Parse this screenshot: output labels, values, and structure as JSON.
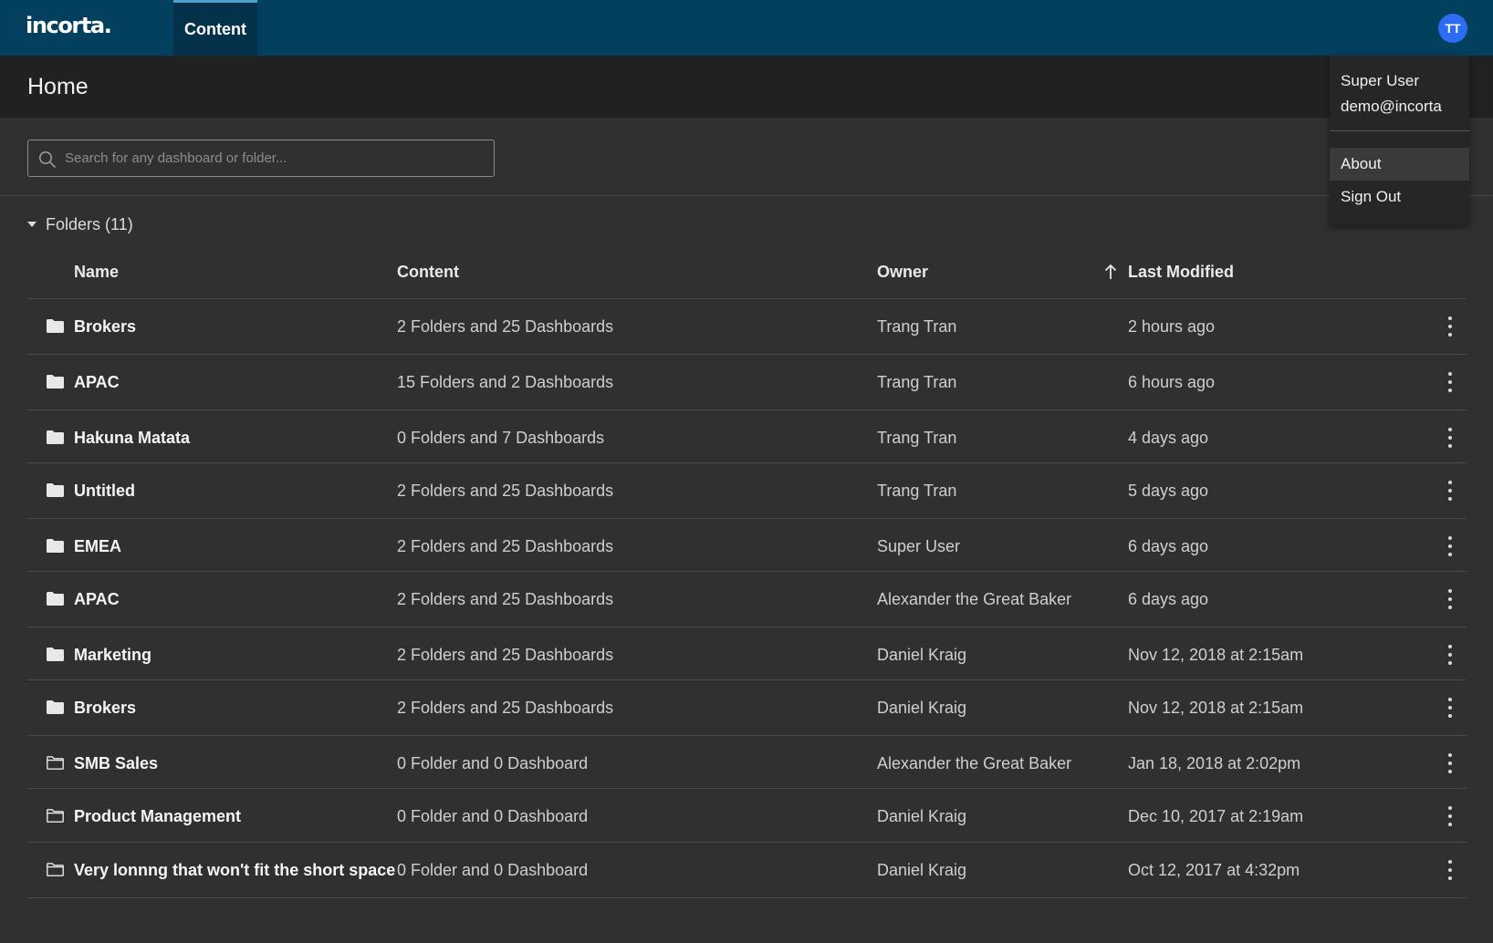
{
  "app": {
    "logo": "incorta.",
    "nav_tab": "Content",
    "avatar_initials": "TT",
    "accent_color": "#03405e",
    "avatar_color": "#2b6cf2"
  },
  "page": {
    "title": "Home"
  },
  "search": {
    "placeholder": "Search for any dashboard or folder..."
  },
  "folders": {
    "toggle_label": "Folders (11)",
    "columns": {
      "name": "Name",
      "content": "Content",
      "owner": "Owner",
      "modified": "Last Modified"
    },
    "sort": {
      "column": "Last Modified",
      "direction": "ascending-arrow"
    },
    "rows": [
      {
        "name": "Brokers",
        "content": "2 Folders and 25 Dashboards",
        "owner": "Trang Tran",
        "modified": "2 hours ago",
        "icon": "folder-filled-icon"
      },
      {
        "name": "APAC",
        "content": "15 Folders and 2 Dashboards",
        "owner": "Trang Tran",
        "modified": "6 hours ago",
        "icon": "folder-filled-icon"
      },
      {
        "name": "Hakuna Matata",
        "content": "0 Folders and 7 Dashboards",
        "owner": "Trang Tran",
        "modified": "4 days ago",
        "icon": "folder-filled-icon"
      },
      {
        "name": "Untitled",
        "content": "2 Folders and 25 Dashboards",
        "owner": "Trang Tran",
        "modified": "5 days ago",
        "icon": "folder-filled-icon"
      },
      {
        "name": "EMEA",
        "content": "2 Folders and 25 Dashboards",
        "owner": "Super User",
        "modified": "6 days ago",
        "icon": "folder-filled-icon"
      },
      {
        "name": "APAC",
        "content": "2 Folders and 25 Dashboards",
        "owner": "Alexander the Great Baker",
        "modified": "6 days ago",
        "icon": "folder-filled-icon"
      },
      {
        "name": "Marketing",
        "content": "2 Folders and 25 Dashboards",
        "owner": "Daniel Kraig",
        "modified": "Nov 12, 2018 at 2:15am",
        "icon": "folder-filled-icon"
      },
      {
        "name": "Brokers",
        "content": "2 Folders and 25 Dashboards",
        "owner": "Daniel Kraig",
        "modified": "Nov 12, 2018 at 2:15am",
        "icon": "folder-filled-icon"
      },
      {
        "name": "SMB Sales",
        "content": "0 Folder and 0 Dashboard",
        "owner": "Alexander the Great Baker",
        "modified": "Jan 18, 2018 at 2:02pm",
        "icon": "folder-outline-icon"
      },
      {
        "name": "Product Management",
        "content": "0 Folder and 0 Dashboard",
        "owner": "Daniel Kraig",
        "modified": "Dec 10, 2017 at 2:19am",
        "icon": "folder-outline-icon"
      },
      {
        "name": "Very lonnng that won't fit the short space",
        "content": "0 Folder and 0 Dashboard",
        "owner": "Daniel Kraig",
        "modified": "Oct 12, 2017 at 4:32pm",
        "icon": "folder-outline-icon"
      }
    ]
  },
  "user_menu": {
    "name": "Super User",
    "email": "demo@incorta",
    "items": [
      "About",
      "Sign Out"
    ]
  }
}
